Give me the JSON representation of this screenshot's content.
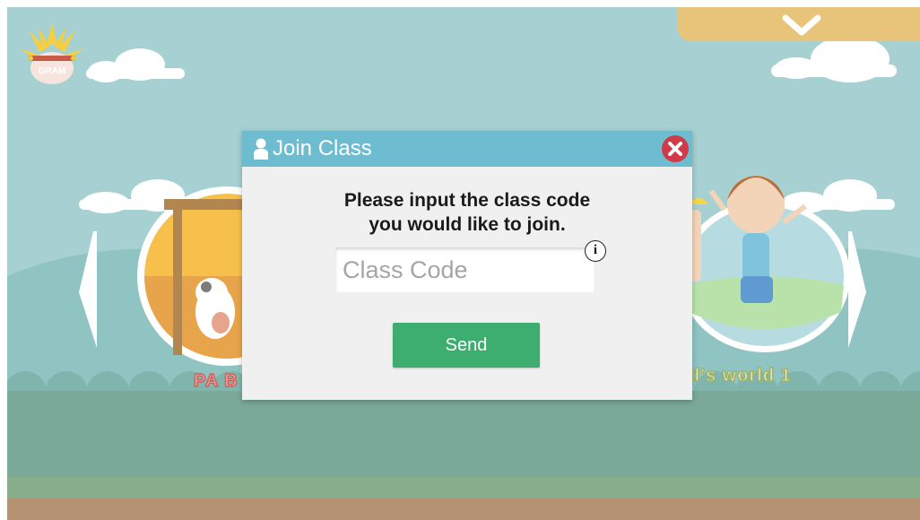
{
  "app": {
    "logo_text": "GRAM",
    "book_left_label": "PA B",
    "book_right_label": "d's world 1"
  },
  "dialog": {
    "title": "Join Class",
    "message": "Please input the class code\nyou would like to join.",
    "input_placeholder": "Class Code",
    "input_value": "",
    "info_label": "i",
    "send_label": "Send"
  },
  "colors": {
    "sky": "#a6d0d1",
    "dialog_header": "#6dbcd0",
    "send_button": "#3dad70",
    "close_button": "#d13a47",
    "top_menu_bar": "#e8c37a"
  },
  "icons": {
    "header_icon": "user-icon",
    "close_icon": "close-icon",
    "info_icon": "info-icon",
    "menu_toggle_icon": "chevron-down-icon",
    "book_prev_icon": "chevron-left-icon",
    "book_next_icon": "chevron-right-icon"
  }
}
